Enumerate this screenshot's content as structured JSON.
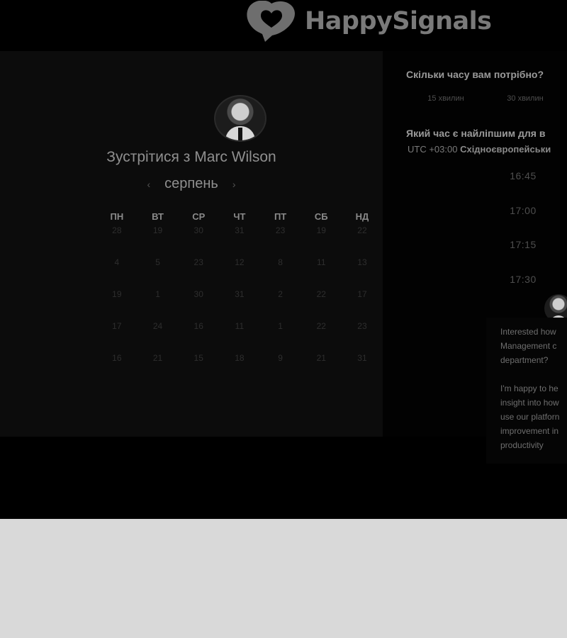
{
  "brand": {
    "name": "HappySignals"
  },
  "calendar": {
    "title": "Зустрітися з Marc Wilson",
    "month": "серпень",
    "prev_arrow": "‹",
    "next_arrow": "›",
    "weekdays": [
      "ПН",
      "ВТ",
      "СР",
      "ЧТ",
      "ПТ",
      "СБ",
      "НД"
    ],
    "days": [
      "28",
      "19",
      "30",
      "31",
      "23",
      "19",
      "22",
      "4",
      "5",
      "23",
      "12",
      "8",
      "11",
      "13",
      "19",
      "1",
      "30",
      "31",
      "2",
      "22",
      "17",
      "17",
      "24",
      "16",
      "11",
      "1",
      "22",
      "23",
      "16",
      "21",
      "15",
      "18",
      "9",
      "21",
      "31"
    ]
  },
  "scheduler": {
    "duration_question": "Скільки часу вам потрібно?",
    "durations": [
      "15 хвилин",
      "30 хвилин"
    ],
    "time_question": "Який час є найліпшим для в",
    "timezone_prefix": "UTC +03:00",
    "timezone_name": "Східноєвропейськи",
    "slots": [
      "16:45",
      "17:00",
      "17:15",
      "17:30"
    ]
  },
  "chat": {
    "lines_1": [
      "Interested how",
      "Management c",
      "department?"
    ],
    "lines_2": [
      "I'm happy to he",
      "insight into how",
      "use our platforn",
      "improvement in",
      "productivity"
    ]
  }
}
